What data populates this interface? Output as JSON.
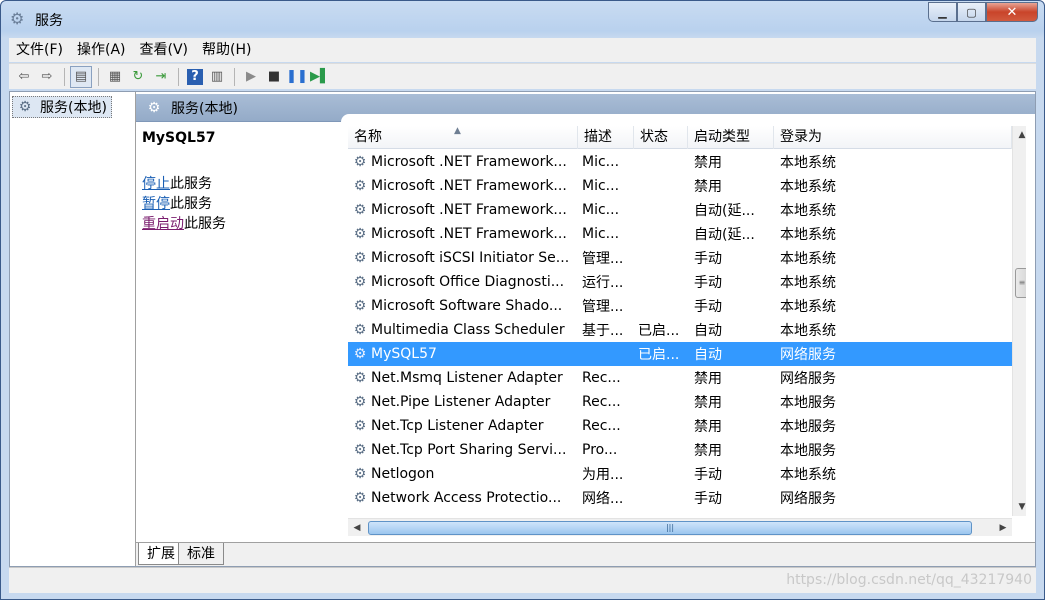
{
  "window": {
    "title": "服务",
    "icon": "gear-icon"
  },
  "menu": [
    "文件(F)",
    "操作(A)",
    "查看(V)",
    "帮助(H)"
  ],
  "tree": {
    "root_label": "服务(本地)"
  },
  "pane": {
    "header_label": "服务(本地)"
  },
  "detail": {
    "service_name": "MySQL57",
    "stop_link": "停止",
    "stop_suffix": "此服务",
    "pause_link": "暂停",
    "pause_suffix": "此服务",
    "restart_link": "重启动",
    "restart_suffix": "此服务"
  },
  "columns": {
    "name": "名称",
    "desc": "描述",
    "status": "状态",
    "startup": "启动类型",
    "logon": "登录为"
  },
  "rows": [
    {
      "name": "Microsoft .NET Framework...",
      "desc": "Mic...",
      "status": "",
      "startup": "禁用",
      "logon": "本地系统"
    },
    {
      "name": "Microsoft .NET Framework...",
      "desc": "Mic...",
      "status": "",
      "startup": "禁用",
      "logon": "本地系统"
    },
    {
      "name": "Microsoft .NET Framework...",
      "desc": "Mic...",
      "status": "",
      "startup": "自动(延...",
      "logon": "本地系统"
    },
    {
      "name": "Microsoft .NET Framework...",
      "desc": "Mic...",
      "status": "",
      "startup": "自动(延...",
      "logon": "本地系统"
    },
    {
      "name": "Microsoft iSCSI Initiator Se...",
      "desc": "管理...",
      "status": "",
      "startup": "手动",
      "logon": "本地系统"
    },
    {
      "name": "Microsoft Office Diagnosti...",
      "desc": "运行...",
      "status": "",
      "startup": "手动",
      "logon": "本地系统"
    },
    {
      "name": "Microsoft Software Shado...",
      "desc": "管理...",
      "status": "",
      "startup": "手动",
      "logon": "本地系统"
    },
    {
      "name": "Multimedia Class Scheduler",
      "desc": "基于...",
      "status": "已启...",
      "startup": "自动",
      "logon": "本地系统"
    },
    {
      "name": "MySQL57",
      "desc": "",
      "status": "已启...",
      "startup": "自动",
      "logon": "网络服务"
    },
    {
      "name": "Net.Msmq Listener Adapter",
      "desc": "Rec...",
      "status": "",
      "startup": "禁用",
      "logon": "网络服务"
    },
    {
      "name": "Net.Pipe Listener Adapter",
      "desc": "Rec...",
      "status": "",
      "startup": "禁用",
      "logon": "本地服务"
    },
    {
      "name": "Net.Tcp Listener Adapter",
      "desc": "Rec...",
      "status": "",
      "startup": "禁用",
      "logon": "本地服务"
    },
    {
      "name": "Net.Tcp Port Sharing Servi...",
      "desc": "Pro...",
      "status": "",
      "startup": "禁用",
      "logon": "本地服务"
    },
    {
      "name": "Netlogon",
      "desc": "为用...",
      "status": "",
      "startup": "手动",
      "logon": "本地系统"
    },
    {
      "name": "Network Access Protectio...",
      "desc": "网络...",
      "status": "",
      "startup": "手动",
      "logon": "网络服务"
    }
  ],
  "selected_row": 8,
  "tabs": [
    "扩展",
    "标准"
  ],
  "active_tab": 0,
  "watermark": "https://blog.csdn.net/qq_43217940",
  "colors": {
    "selection": "#3399ff",
    "header": "#94abc8"
  }
}
